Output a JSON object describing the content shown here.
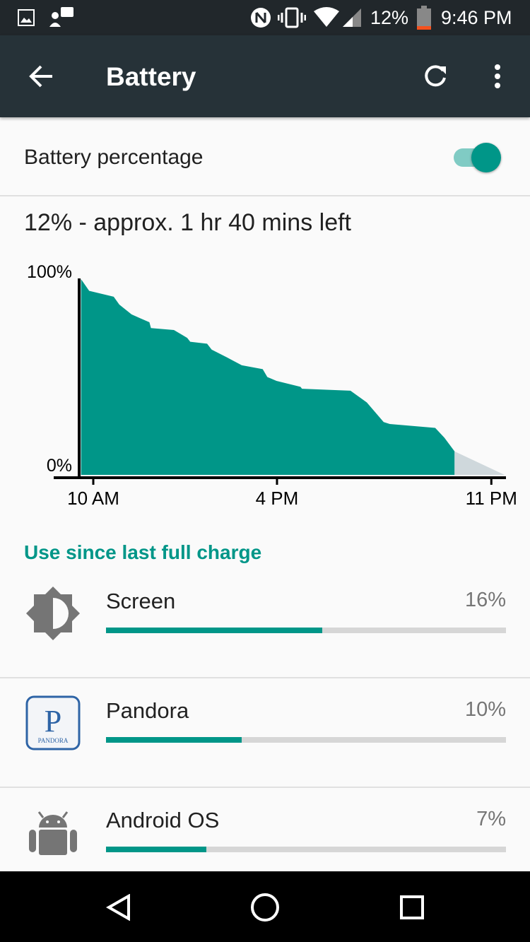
{
  "status_bar": {
    "battery": "12%",
    "time": "9:46 PM",
    "icons": [
      "image-icon",
      "chat-icon",
      "nfc-icon",
      "vibrate-icon",
      "wifi-icon",
      "signal-icon",
      "battery-icon"
    ]
  },
  "app_bar": {
    "title": "Battery",
    "icons": [
      "back-arrow-icon",
      "refresh-icon",
      "more-vert-icon"
    ]
  },
  "battery_percentage": {
    "label": "Battery percentage",
    "enabled": true
  },
  "summary": "12% - approx. 1 hr 40 mins left",
  "colors": {
    "accent": "#009688",
    "toolbar": "#263238",
    "projection": "#cfd8dc"
  },
  "chart_data": {
    "type": "area",
    "ylim": [
      0,
      100
    ],
    "y_tick_labels": [
      "100%",
      "0%"
    ],
    "x_tick_labels": [
      "10 AM",
      "4 PM",
      "11 PM"
    ],
    "x_ticks": [
      "10:00",
      "16:00",
      "23:00"
    ],
    "series": [
      {
        "x": [
          "09:36",
          "09:52",
          "10:40",
          "10:51",
          "11:15",
          "11:32",
          "11:50",
          "11:53",
          "12:38",
          "13:04",
          "13:10",
          "13:43",
          "13:52",
          "14:22",
          "14:51",
          "15:32",
          "15:41",
          "15:59",
          "16:46",
          "16:49",
          "18:24",
          "18:56",
          "19:29",
          "19:41",
          "21:10",
          "21:28",
          "21:48"
        ],
        "y": [
          100,
          94,
          91,
          87,
          82,
          80,
          78,
          75,
          74,
          70,
          68,
          67,
          64,
          60,
          56,
          54,
          50,
          48,
          45,
          44,
          43,
          37,
          27,
          26,
          24,
          19,
          12
        ]
      }
    ],
    "projection": {
      "x": [
        "21:48",
        "23:26"
      ],
      "y": [
        12,
        0
      ]
    }
  },
  "section_title": "Use since last full charge",
  "apps": [
    {
      "name": "Screen",
      "percent": "16%",
      "bar": 0.54,
      "icon": "brightness-icon"
    },
    {
      "name": "Pandora",
      "percent": "10%",
      "bar": 0.34,
      "icon": "pandora-icon",
      "logo_text": "PANDORA"
    },
    {
      "name": "Android OS",
      "percent": "7%",
      "bar": 0.25,
      "icon": "android-icon"
    }
  ],
  "nav_bar": {
    "icons": [
      "back-icon",
      "home-icon",
      "recents-icon"
    ]
  }
}
